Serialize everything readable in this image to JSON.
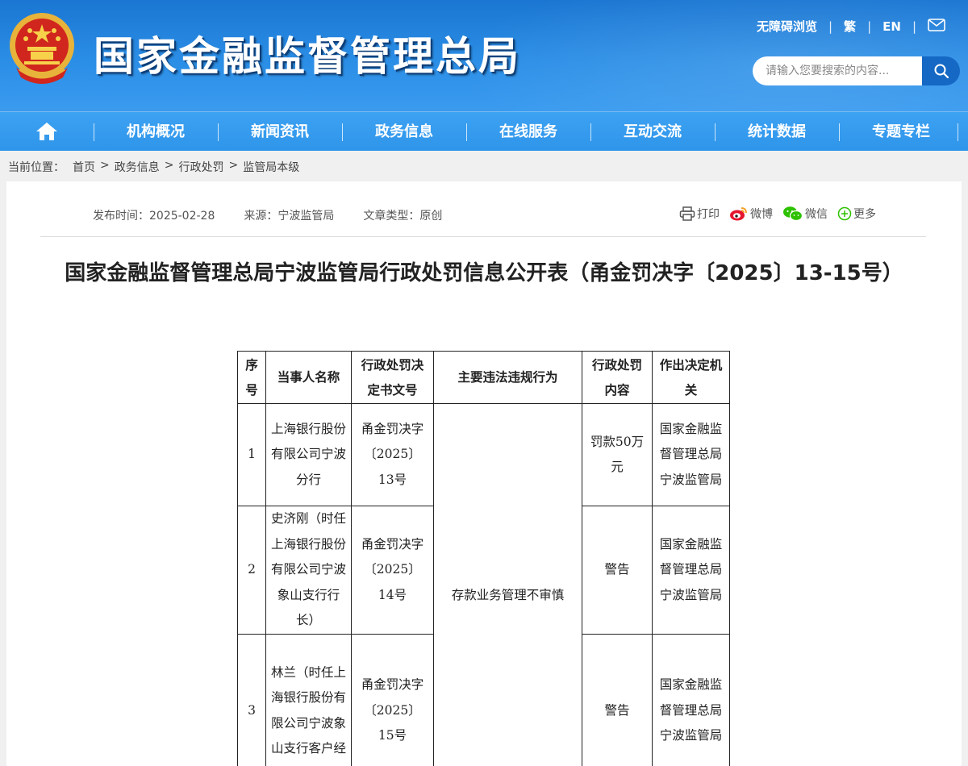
{
  "header": {
    "site_title": "国家金融监督管理总局",
    "links": {
      "accessible": "无障碍浏览",
      "traditional": "繁",
      "english": "EN"
    },
    "search_placeholder": "请输入您要搜索的内容..."
  },
  "nav": {
    "items": [
      "机构概况",
      "新闻资讯",
      "政务信息",
      "在线服务",
      "互动交流",
      "统计数据",
      "专题专栏"
    ]
  },
  "breadcrumb": {
    "label": "当前位置：",
    "items": [
      "首页",
      "政务信息",
      "行政处罚",
      "监管局本级"
    ],
    "separator": ">"
  },
  "article": {
    "publish_time": "发布时间：2025-02-28",
    "source": "来源：宁波监管局",
    "type": "文章类型：原创",
    "share": {
      "print": "打印",
      "weibo": "微博",
      "wechat": "微信",
      "more": "更多"
    },
    "title": "国家金融监督管理总局宁波监管局行政处罚信息公开表（甬金罚决字〔2025〕13-15号）"
  },
  "table": {
    "headers": [
      "序号",
      "当事人名称",
      "行政处罚决定书文号",
      "主要违法违规行为",
      "行政处罚内容",
      "作出决定机关"
    ],
    "shared_violation": "存款业务管理不审慎",
    "rows": [
      {
        "no": "1",
        "party": "上海银行股份有限公司宁波分行",
        "doc": "甬金罚决字〔2025〕13号",
        "penalty": "罚款50万元",
        "authority": "国家金融监督管理总局宁波监管局"
      },
      {
        "no": "2",
        "party": "史济刚（时任上海银行股份有限公司宁波象山支行行长）",
        "doc": "甬金罚决字〔2025〕14号",
        "penalty": "警告",
        "authority": "国家金融监督管理总局宁波监管局"
      },
      {
        "no": "3",
        "party": "林兰（时任上海银行股份有限公司宁波象山支行客户经",
        "doc": "甬金罚决字〔2025〕15号",
        "penalty": "警告",
        "authority": "国家金融监督管理总局宁波监管局"
      }
    ]
  },
  "colors": {
    "header_blue": "#2b8ee6",
    "nav_blue": "#3da2f2",
    "search_button": "#1568c4"
  }
}
